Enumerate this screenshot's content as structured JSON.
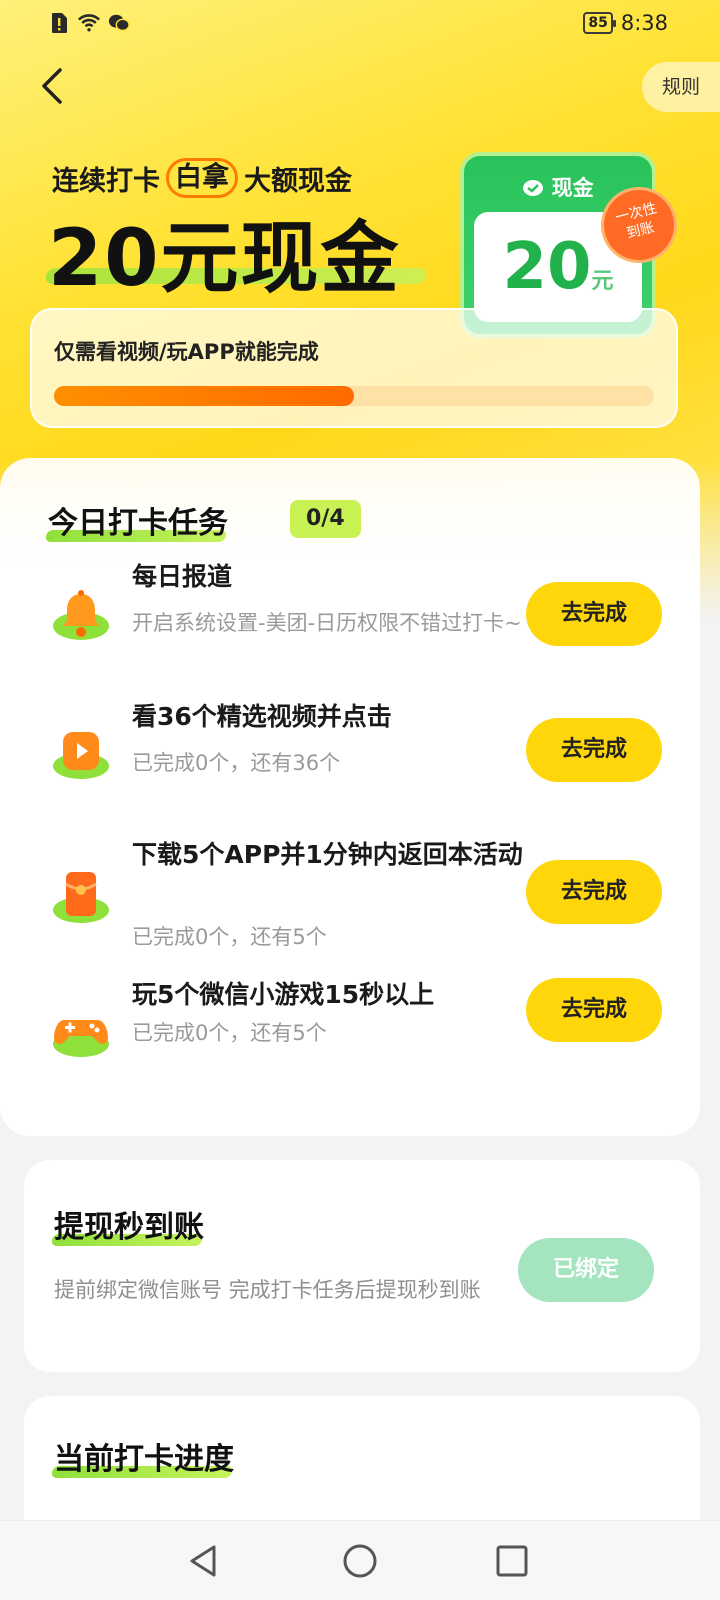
{
  "status_bar": {
    "battery": "85",
    "time": "8:38"
  },
  "header": {
    "rules_label": "规则"
  },
  "hero": {
    "headline_prefix": "连续打卡",
    "headline_circled": "白拿",
    "headline_suffix": "大额现金",
    "big_title": "20元现金",
    "cash_card": {
      "label": "现金",
      "amount": "20",
      "unit": "元",
      "badge_line1": "一次性",
      "badge_line2": "到账"
    },
    "progress_text": "仅需看视频/玩APP就能完成",
    "progress_fraction": 0.5,
    "progress_color": "#ff7a00"
  },
  "tasks": {
    "title": "今日打卡任务",
    "count": "0/4",
    "items": [
      {
        "name": "每日报道",
        "sub": "开启系统设置-美团-日历权限不错过打卡~",
        "button": "去完成",
        "icon": "bell-icon"
      },
      {
        "name": "看36个精选视频并点击",
        "sub": "已完成0个，还有36个",
        "button": "去完成",
        "icon": "play-icon"
      },
      {
        "name": "下载5个APP并1分钟内返回本活动",
        "sub": "已完成0个，还有5个",
        "button": "去完成",
        "icon": "red-packet-icon"
      },
      {
        "name": "玩5个微信小游戏15秒以上",
        "sub": "已完成0个，还有5个",
        "button": "去完成",
        "icon": "gamepad-icon"
      }
    ]
  },
  "withdraw": {
    "title": "提现秒到账",
    "sub": "提前绑定微信账号 完成打卡任务后提现秒到账",
    "button": "已绑定"
  },
  "checkin_progress": {
    "title": "当前打卡进度"
  }
}
